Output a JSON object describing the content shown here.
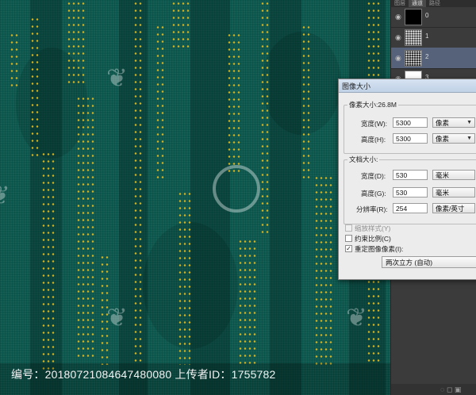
{
  "layers_panel": {
    "tabs": [
      "图层",
      "通道",
      "路径"
    ],
    "active_tab_index": 1,
    "channels": [
      {
        "name": "0",
        "thumb": "black"
      },
      {
        "name": "1",
        "thumb": "noise"
      },
      {
        "name": "2",
        "thumb": "noise",
        "selected": true
      },
      {
        "name": "3",
        "thumb": "white"
      }
    ]
  },
  "dialog": {
    "title": "图像大小",
    "pixel_dimensions": {
      "legend": "像素大小:26.8M",
      "width_label": "宽度(W):",
      "width_value": "5300",
      "width_unit": "像素",
      "height_label": "高度(H):",
      "height_value": "5300",
      "height_unit": "像素"
    },
    "document_size": {
      "legend": "文档大小:",
      "width_label": "宽度(D):",
      "width_value": "530",
      "width_unit": "毫米",
      "height_label": "高度(G):",
      "height_value": "530",
      "height_unit": "毫米",
      "resolution_label": "分辨率(R):",
      "resolution_value": "254",
      "resolution_unit": "像素/英寸"
    },
    "options": {
      "scale_styles": "缩放样式(Y)",
      "scale_styles_checked": false,
      "constrain": "约束比例(C)",
      "constrain_checked": false,
      "resample": "重定图像像素(I):",
      "resample_checked": true,
      "resample_method": "两次立方 (自动)"
    }
  },
  "footer": {
    "text": "编号：20180721084647480080 上传者ID：1755782"
  },
  "colors": {
    "background": "#0e5a50",
    "dots": "#d8b31d"
  }
}
